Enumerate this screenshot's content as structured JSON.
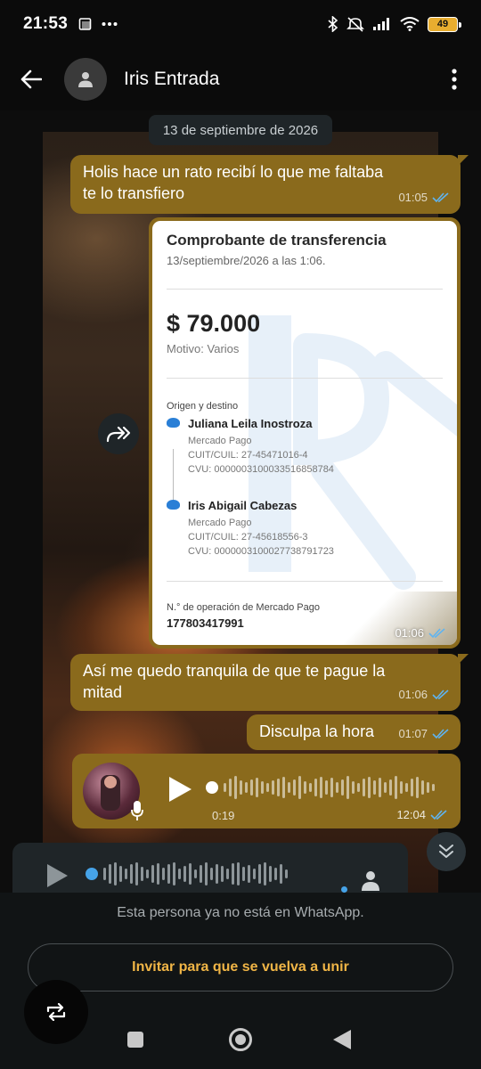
{
  "status_bar": {
    "time": "21:53",
    "battery": "49"
  },
  "header": {
    "contact_name": "Iris Entrada"
  },
  "chat": {
    "date_chip": "13 de septiembre de 2026",
    "messages": [
      {
        "text": "Holis hace un rato recibí  lo que me faltaba te lo transfiero",
        "time": "01:05"
      },
      {
        "text": "Así me quedo tranquila de que te pague la mitad",
        "time": "01:06"
      },
      {
        "text": "Disculpa la hora",
        "time": "01:07"
      }
    ],
    "receipt": {
      "title": "Comprobante de transferencia",
      "date": "13/septiembre/2026 a las 1:06.",
      "amount": "$ 79.000",
      "reason": "Motivo: Varios",
      "origin_destination_label": "Origen y destino",
      "sender": {
        "name": "Juliana Leila Inostroza",
        "bank": "Mercado Pago",
        "cuit": "CUIT/CUIL: 27-45471016-4",
        "cvu": "CVU: 0000003100033516858784"
      },
      "recipient": {
        "name": "Iris Abigail Cabezas",
        "bank": "Mercado Pago",
        "cuit": "CUIT/CUIL: 27-45618556-3",
        "cvu": "CVU: 0000003100027738791723"
      },
      "operation_label": "N.° de operación de Mercado Pago",
      "operation_number": "177803417991",
      "time": "01:06"
    },
    "voice_message": {
      "duration": "0:19",
      "time": "12:04"
    }
  },
  "footer": {
    "notice": "Esta persona ya no está en WhatsApp.",
    "invite_button": "Invitar para que se vuelva a unir"
  },
  "colors": {
    "bubble": "#8a6a1c",
    "accent": "#f0b546",
    "read_ticks": "#5fb4f0"
  }
}
